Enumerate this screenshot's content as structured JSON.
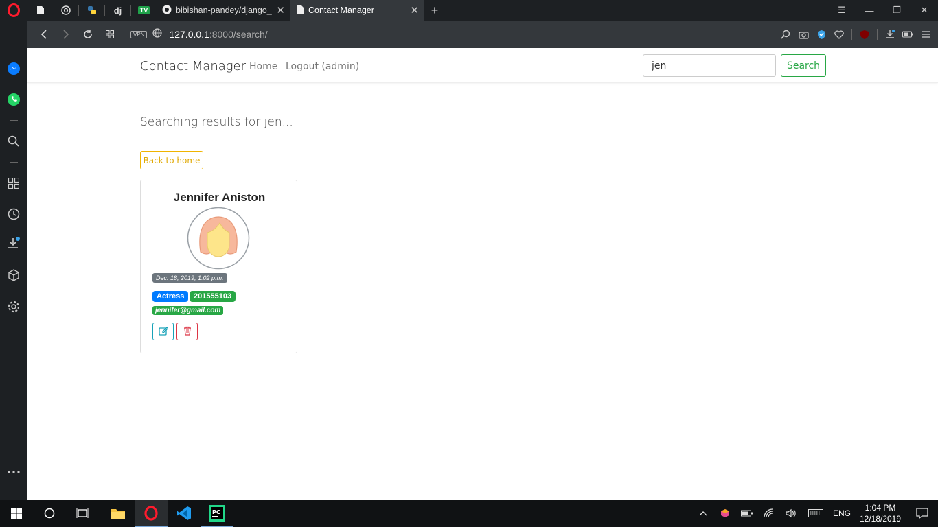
{
  "browser": {
    "tabs": [
      {
        "title": "bibishan-pandey/django_contact",
        "active": false
      },
      {
        "title": "Contact Manager",
        "active": true
      }
    ],
    "pinned_icons": [
      "document-icon",
      "chatgpt-icon",
      "python-icon",
      "django-icon",
      "tv-icon"
    ],
    "pinned_django_label": "dj",
    "pinned_tv_label": "TV",
    "new_tab": "+",
    "vpn_label": "VPN",
    "url_host": "127.0.0.1",
    "url_rest": ":8000/search/"
  },
  "navbar": {
    "brand": "Contact Manager",
    "links": [
      "Home",
      "Logout (admin)"
    ],
    "search_value": "jen",
    "search_button": "Search"
  },
  "main": {
    "heading": "Searching results for jen...",
    "back_button": "Back to home"
  },
  "contact": {
    "name": "Jennifer Aniston",
    "date": "Dec. 18, 2019, 1:02 p.m.",
    "role": "Actress",
    "phone": "201555103",
    "email": "jennifer@gmail.com"
  },
  "taskbar": {
    "lang": "ENG",
    "time": "1:04 PM",
    "date": "12/18/2019"
  },
  "colors": {
    "primary": "#007bff",
    "success": "#28a745",
    "warning": "#f0b400",
    "info": "#17a2b8",
    "danger": "#dc3545"
  }
}
